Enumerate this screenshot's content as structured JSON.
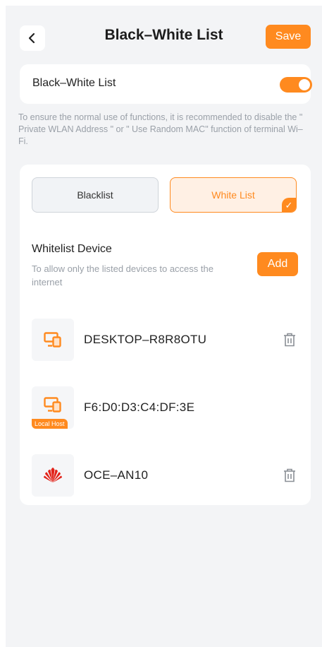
{
  "header": {
    "title": "Black–White List",
    "save_label": "Save"
  },
  "toggle_row": {
    "label": "Black–White List",
    "enabled": true
  },
  "notice": "To ensure the normal use of functions, it is recommended to disable the \" Private WLAN Address \" or \" Use Random MAC\" function of terminal Wi–Fi.",
  "mode_tabs": {
    "blacklist_label": "Blacklist",
    "whitelist_label": "White List",
    "selected": "White List"
  },
  "whitelist": {
    "title": "Whitelist Device",
    "description": "To allow only the listed devices to access the internet",
    "add_label": "Add"
  },
  "devices": [
    {
      "name": "DESKTOP–R8R8OTU",
      "icon": "computer-icon",
      "tag": "",
      "deletable": true
    },
    {
      "name": "F6:D0:D3:C4:DF:3E",
      "icon": "computer-icon",
      "tag": "Local Host",
      "deletable": false
    },
    {
      "name": "OCE–AN10",
      "icon": "huawei-logo-icon",
      "tag": "",
      "deletable": true
    }
  ],
  "colors": {
    "accent": "#ff8a1f",
    "background": "#f3f4f6",
    "muted_text": "#9aa0a8"
  }
}
